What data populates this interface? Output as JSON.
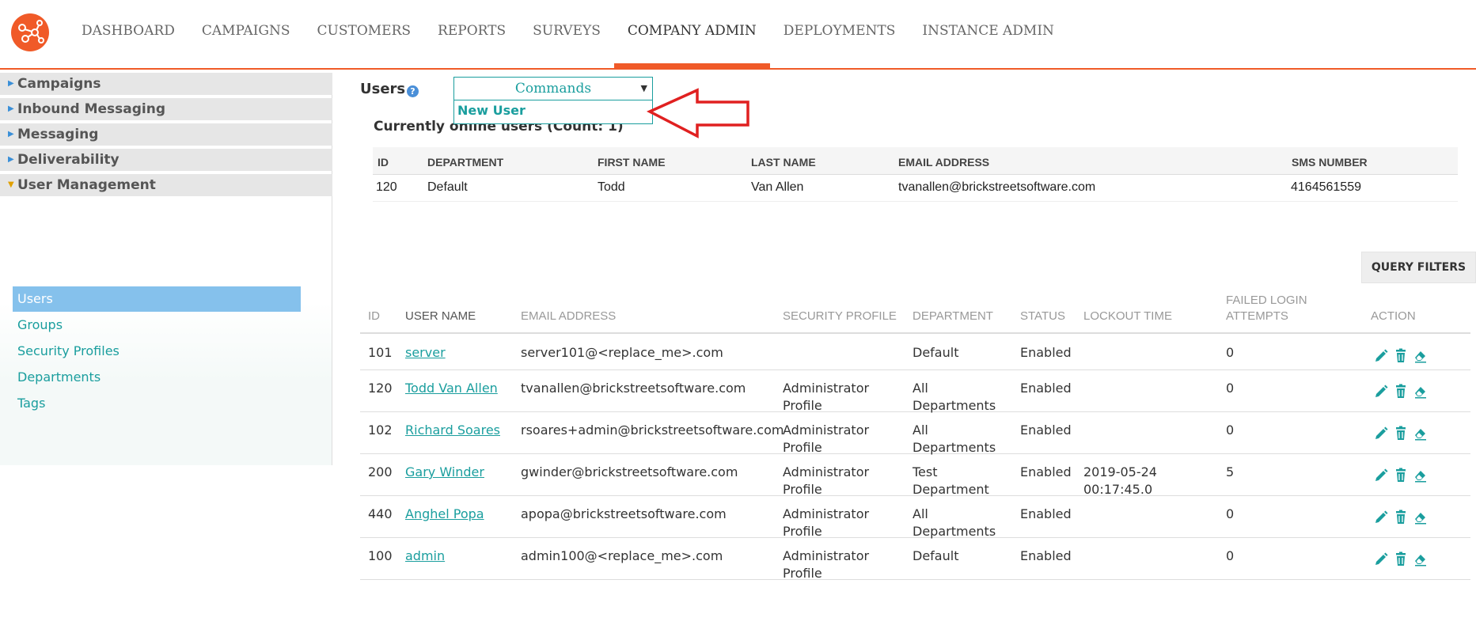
{
  "nav": {
    "items": [
      {
        "label": "DASHBOARD"
      },
      {
        "label": "CAMPAIGNS"
      },
      {
        "label": "CUSTOMERS"
      },
      {
        "label": "REPORTS"
      },
      {
        "label": "SURVEYS"
      },
      {
        "label": "COMPANY ADMIN",
        "active": true
      },
      {
        "label": "DEPLOYMENTS"
      },
      {
        "label": "INSTANCE ADMIN"
      }
    ]
  },
  "sidebar": {
    "sections": [
      {
        "label": "Campaigns",
        "expanded": false
      },
      {
        "label": "Inbound Messaging",
        "expanded": false
      },
      {
        "label": "Messaging",
        "expanded": false
      },
      {
        "label": "Deliverability",
        "expanded": false
      },
      {
        "label": "User Management",
        "expanded": true
      }
    ],
    "items": [
      {
        "label": "Users",
        "active": true
      },
      {
        "label": "Groups"
      },
      {
        "label": "Security Profiles"
      },
      {
        "label": "Departments"
      },
      {
        "label": "Tags"
      }
    ]
  },
  "page": {
    "title": "Users",
    "commands": {
      "label": "Commands",
      "menu_item": "New User"
    },
    "online_title": "Currently online users (Count: 1)",
    "query_filters": "QUERY FILTERS"
  },
  "online_table": {
    "headers": [
      "ID",
      "DEPARTMENT",
      "FIRST NAME",
      "LAST NAME",
      "EMAIL ADDRESS",
      "SMS NUMBER"
    ],
    "rows": [
      [
        "120",
        "Default",
        "Todd",
        "Van Allen",
        "tvanallen@brickstreetsoftware.com",
        "4164561559"
      ]
    ]
  },
  "users_table": {
    "headers": [
      "ID",
      "USER NAME",
      "EMAIL ADDRESS",
      "SECURITY PROFILE",
      "DEPARTMENT",
      "STATUS",
      "LOCKOUT TIME",
      "FAILED LOGIN",
      "ATTEMPTS",
      "ACTION"
    ],
    "rows": [
      {
        "id": "101",
        "user": "server",
        "email": "server101@<replace_me>.com",
        "profile1": "",
        "profile2": "",
        "dept1": "Default",
        "dept2": "",
        "status": "Enabled",
        "lock1": "",
        "lock2": "",
        "failed": "0"
      },
      {
        "id": "120",
        "user": "Todd Van Allen",
        "email": "tvanallen@brickstreetsoftware.com",
        "profile1": "Administrator",
        "profile2": "Profile",
        "dept1": "All",
        "dept2": "Departments",
        "status": "Enabled",
        "lock1": "",
        "lock2": "",
        "failed": "0"
      },
      {
        "id": "102",
        "user": "Richard Soares",
        "email": "rsoares+admin@brickstreetsoftware.com",
        "profile1": "Administrator",
        "profile2": "Profile",
        "dept1": "All",
        "dept2": "Departments",
        "status": "Enabled",
        "lock1": "",
        "lock2": "",
        "failed": "0"
      },
      {
        "id": "200",
        "user": "Gary Winder",
        "email": "gwinder@brickstreetsoftware.com",
        "profile1": "Administrator",
        "profile2": "Profile",
        "dept1": "Test",
        "dept2": "Department",
        "status": "Enabled",
        "lock1": "2019-05-24",
        "lock2": "00:17:45.0",
        "failed": "5"
      },
      {
        "id": "440",
        "user": "Anghel Popa",
        "email": "apopa@brickstreetsoftware.com",
        "profile1": "Administrator",
        "profile2": "Profile",
        "dept1": "All",
        "dept2": "Departments",
        "status": "Enabled",
        "lock1": "",
        "lock2": "",
        "failed": "0"
      },
      {
        "id": "100",
        "user": "admin",
        "email": "admin100@<replace_me>.com",
        "profile1": "Administrator",
        "profile2": "Profile",
        "dept1": "Default",
        "dept2": "",
        "status": "Enabled",
        "lock1": "",
        "lock2": "",
        "failed": "0"
      }
    ]
  },
  "icons": {
    "edit": "pencil-icon",
    "delete": "trash-icon",
    "reset": "eraser-icon",
    "help": "help-icon",
    "annotation": "red-arrow-icon"
  },
  "colors": {
    "accent": "#f05a28",
    "link": "#1a9e9e",
    "active_sidebar": "#85c1ec",
    "arrow": "#e02020"
  }
}
